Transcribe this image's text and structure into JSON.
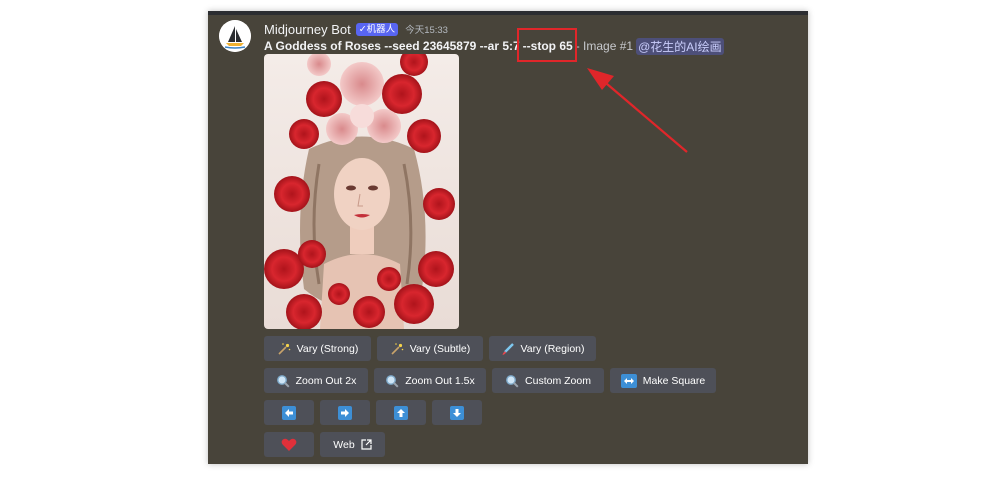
{
  "message": {
    "author": "Midjourney Bot",
    "badge": "✓机器人",
    "timestamp": "今天15:33",
    "prompt": "A Goddess of Roses --seed 23645879 --ar 5:7",
    "stop_param": "--stop 65",
    "suffix": "- Image #1",
    "mention": "@花生的AI绘画"
  },
  "buttons": {
    "vary_strong": "Vary (Strong)",
    "vary_subtle": "Vary (Subtle)",
    "vary_region": "Vary (Region)",
    "zoom_out_2x": "Zoom Out 2x",
    "zoom_out_1_5x": "Zoom Out 1.5x",
    "custom_zoom": "Custom Zoom",
    "make_square": "Make Square",
    "web": "Web"
  },
  "icons": {
    "vary": "magic-wand-icon",
    "region": "paintbrush-icon",
    "zoom": "magnifier-icon",
    "square": "left-right-arrow-icon",
    "pan_left": "arrow-left-icon",
    "pan_right": "arrow-right-icon",
    "pan_up": "arrow-up-icon",
    "pan_down": "arrow-down-icon",
    "like": "heart-icon",
    "external": "external-link-icon"
  },
  "colors": {
    "background": "#48443a",
    "button": "#4e5058",
    "annotation": "#e0262a",
    "bot_badge": "#5865f2"
  }
}
